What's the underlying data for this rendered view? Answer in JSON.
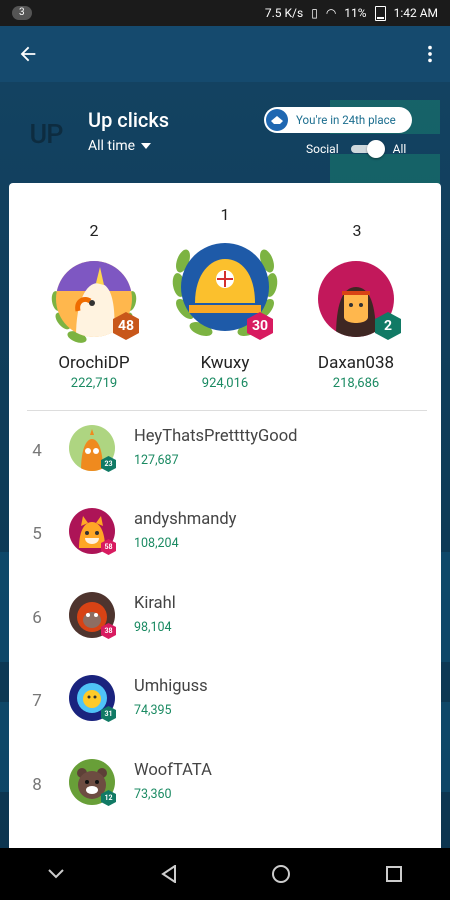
{
  "status": {
    "notif_count": "3",
    "speed": "7.5 K/s",
    "battery": "11%",
    "time": "1:42 AM"
  },
  "header": {
    "logo_text": "UP",
    "title": "Up clicks",
    "time_filter": "All time",
    "rank_text": "You're in 24th place",
    "toggle_left": "Social",
    "toggle_right": "All",
    "toggle_on": true
  },
  "podium": [
    {
      "rank": "2",
      "name": "OrochiDP",
      "score": "222,719",
      "level": "48",
      "level_color": "#c8571a",
      "avatar": "unicorn-avatar"
    },
    {
      "rank": "1",
      "name": "Kwuxy",
      "score": "924,016",
      "level": "30",
      "level_color": "#d81b60",
      "avatar": "baseball-cap-avatar"
    },
    {
      "rank": "3",
      "name": "Daxan038",
      "score": "218,686",
      "level": "2",
      "level_color": "#117a65",
      "avatar": "native-warrior-avatar"
    }
  ],
  "leaderboard": [
    {
      "rank": "4",
      "name": "HeyThatsPrettttyGood",
      "score": "127,687",
      "level": "23",
      "level_color": "#117a65",
      "avatar": "orange-creature-avatar"
    },
    {
      "rank": "5",
      "name": "andyshmandy",
      "score": "108,204",
      "level": "58",
      "level_color": "#d81b60",
      "avatar": "shiba-dog-avatar"
    },
    {
      "rank": "6",
      "name": "Kirahl",
      "score": "98,104",
      "level": "38",
      "level_color": "#d81b60",
      "avatar": "orangutan-avatar"
    },
    {
      "rank": "7",
      "name": "Umhiguss",
      "score": "74,395",
      "level": "31",
      "level_color": "#117a65",
      "avatar": "astronaut-avatar"
    },
    {
      "rank": "8",
      "name": "WoofTATA",
      "score": "73,360",
      "level": "12",
      "level_color": "#117a65",
      "avatar": "bear-avatar"
    }
  ],
  "colors": {
    "appbar": "#154a6e",
    "score_green": "#1a8a62",
    "accent_pink": "#d81b60",
    "accent_teal": "#117a65"
  }
}
